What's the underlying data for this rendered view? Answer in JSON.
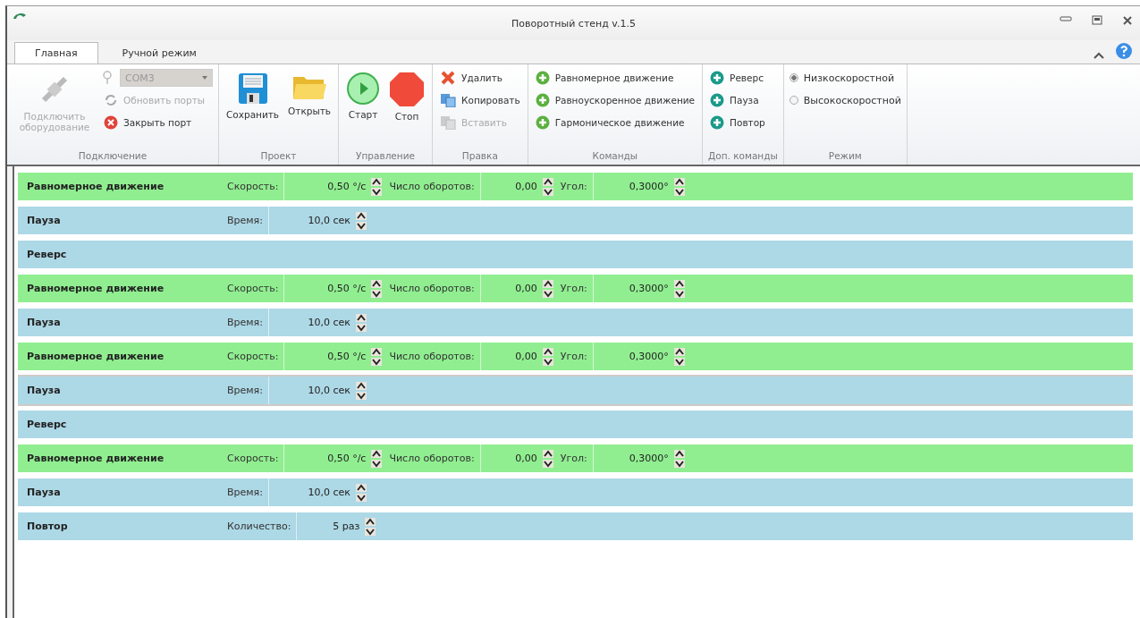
{
  "window": {
    "title": "Поворотный стенд v.1.5"
  },
  "tabs": [
    {
      "label": "Главная",
      "selected": true
    },
    {
      "label": "Ручной режим",
      "selected": false
    }
  ],
  "ribbon": [
    {
      "kind": "connection",
      "label": "Подключение",
      "connect": {
        "label": "Подключить оборудование",
        "disabled": true
      },
      "port": {
        "value": "COM3",
        "disabled": true
      },
      "items": [
        {
          "kind": "refresh",
          "label": "Обновить порты",
          "disabled": true
        },
        {
          "kind": "close",
          "label": "Закрыть порт",
          "disabled": false
        }
      ]
    },
    {
      "kind": "large",
      "label": "Проект",
      "items": [
        {
          "kind": "save",
          "label": "Сохранить"
        },
        {
          "kind": "open",
          "label": "Открыть"
        }
      ]
    },
    {
      "kind": "large",
      "label": "Управление",
      "items": [
        {
          "kind": "start",
          "label": "Старт"
        },
        {
          "kind": "stop",
          "label": "Стоп"
        }
      ]
    },
    {
      "kind": "small",
      "label": "Правка",
      "items": [
        {
          "kind": "delete",
          "label": "Удалить",
          "disabled": false
        },
        {
          "kind": "copy",
          "label": "Копировать",
          "disabled": false
        },
        {
          "kind": "paste",
          "label": "Вставить",
          "disabled": true
        }
      ]
    },
    {
      "kind": "small",
      "label": "Команды",
      "items": [
        {
          "kind": "add-green",
          "label": "Равномерное движение",
          "disabled": false
        },
        {
          "kind": "add-green",
          "label": "Равноускоренное движение",
          "disabled": false
        },
        {
          "kind": "add-green",
          "label": "Гармоническое движение",
          "disabled": false
        }
      ]
    },
    {
      "kind": "small",
      "label": "Доп. команды",
      "items": [
        {
          "kind": "add-teal",
          "label": "Реверс",
          "disabled": false
        },
        {
          "kind": "add-teal",
          "label": "Пауза",
          "disabled": false
        },
        {
          "kind": "add-teal",
          "label": "Повтор",
          "disabled": false
        }
      ]
    },
    {
      "kind": "radio",
      "label": "Режим",
      "items": [
        {
          "label": "Низкоскоростной",
          "selected": true
        },
        {
          "label": "Высокоскоростной",
          "selected": false
        }
      ]
    }
  ],
  "program": [
    {
      "kind": "motion",
      "title": "Равномерное движение",
      "selected": false,
      "fields": [
        {
          "label": "Скорость:",
          "value": "0,50 °/с"
        },
        {
          "label": "Число оборотов:",
          "value": "0,00"
        },
        {
          "label": "Угол:",
          "value": "0,3000°"
        }
      ]
    },
    {
      "kind": "pause",
      "title": "Пауза",
      "selected": false,
      "fields": [
        {
          "label": "Время:",
          "value": "10,0 сек"
        }
      ]
    },
    {
      "kind": "reverse",
      "title": "Реверс",
      "selected": false
    },
    {
      "kind": "motion",
      "title": "Равномерное движение",
      "selected": false,
      "fields": [
        {
          "label": "Скорость:",
          "value": "0,50 °/с"
        },
        {
          "label": "Число оборотов:",
          "value": "0,00"
        },
        {
          "label": "Угол:",
          "value": "0,3000°"
        }
      ]
    },
    {
      "kind": "pause",
      "title": "Пауза",
      "selected": false,
      "fields": [
        {
          "label": "Время:",
          "value": "10,0 сек"
        }
      ]
    },
    {
      "kind": "motion",
      "title": "Равномерное движение",
      "selected": false,
      "fields": [
        {
          "label": "Скорость:",
          "value": "0,50 °/с"
        },
        {
          "label": "Число оборотов:",
          "value": "0,00"
        },
        {
          "label": "Угол:",
          "value": "0,3000°"
        }
      ]
    },
    {
      "kind": "pause",
      "title": "Пауза",
      "selected": true,
      "fields": [
        {
          "label": "Время:",
          "value": "10,0 сек"
        }
      ]
    },
    {
      "kind": "reverse",
      "title": "Реверс",
      "selected": false
    },
    {
      "kind": "motion",
      "title": "Равномерное движение",
      "selected": false,
      "fields": [
        {
          "label": "Скорость:",
          "value": "0,50 °/с"
        },
        {
          "label": "Число оборотов:",
          "value": "0,00"
        },
        {
          "label": "Угол:",
          "value": "0,3000°"
        }
      ]
    },
    {
      "kind": "pause",
      "title": "Пауза",
      "selected": false,
      "fields": [
        {
          "label": "Время:",
          "value": "10,0 сек"
        }
      ]
    },
    {
      "kind": "repeat",
      "title": "Повтор",
      "selected": false,
      "fields": [
        {
          "label": "Количество:",
          "value": "5 раз"
        }
      ]
    }
  ]
}
